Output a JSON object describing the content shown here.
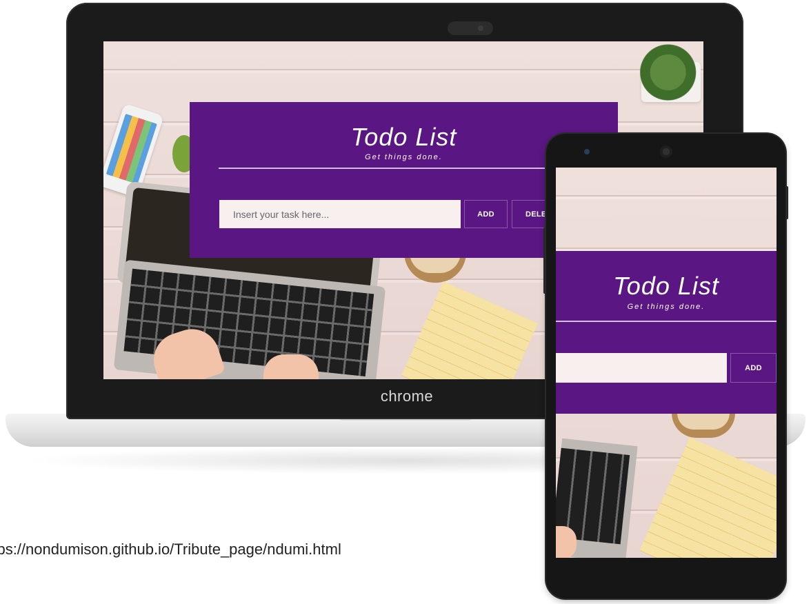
{
  "brand": {
    "label": "chrome"
  },
  "todo_app": {
    "title": "Todo List",
    "subtitle": "Get things done.",
    "input_placeholder": "Insert your task here...",
    "add_button_label": "ADD",
    "delete_button_label": "DELETE"
  },
  "caption": {
    "url_text": "https://nondumison.github.io/Tribute_page/ndumi.html"
  },
  "colors": {
    "panel_purple": "#5a1682",
    "input_bg": "#f7f0ef",
    "divider": "#d3bfe0",
    "device_frame": "#1b1b1b"
  },
  "icons": [
    "laptop-camera-icon",
    "phone-camera-icon",
    "phone-speaker-icon"
  ]
}
